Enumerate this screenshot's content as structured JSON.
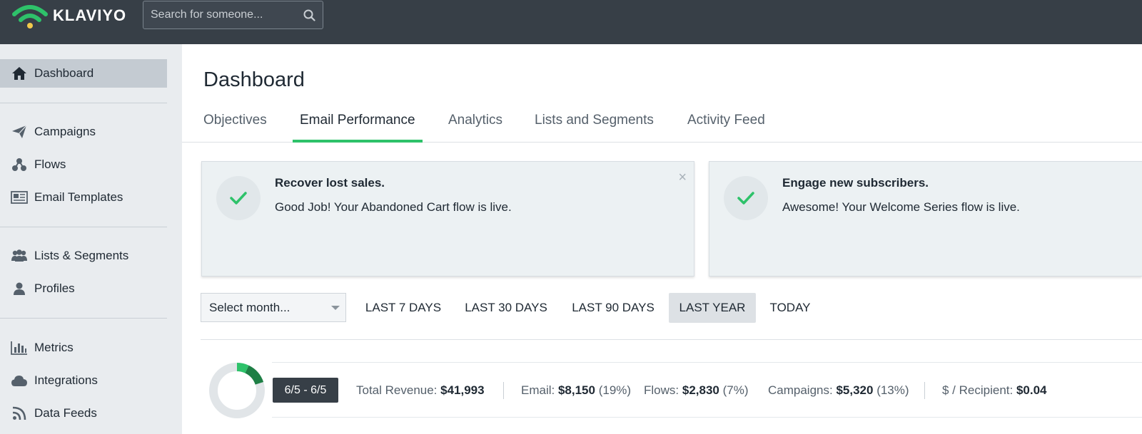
{
  "app": {
    "brand": "KLAVIYO",
    "search_placeholder": "Search for someone..."
  },
  "sidebar": {
    "items": [
      {
        "label": "Dashboard",
        "icon": "home-icon",
        "active": true
      },
      {
        "label": "Campaigns",
        "icon": "paper-plane-icon"
      },
      {
        "label": "Flows",
        "icon": "flows-icon"
      },
      {
        "label": "Email Templates",
        "icon": "newspaper-icon"
      },
      {
        "label": "Lists & Segments",
        "icon": "users-icon"
      },
      {
        "label": "Profiles",
        "icon": "user-icon"
      },
      {
        "label": "Metrics",
        "icon": "bar-chart-icon"
      },
      {
        "label": "Integrations",
        "icon": "cloud-icon"
      },
      {
        "label": "Data Feeds",
        "icon": "rss-icon"
      }
    ]
  },
  "main": {
    "title": "Dashboard",
    "tabs": [
      {
        "label": "Objectives"
      },
      {
        "label": "Email Performance",
        "active": true
      },
      {
        "label": "Analytics"
      },
      {
        "label": "Lists and Segments"
      },
      {
        "label": "Activity Feed"
      }
    ],
    "cards": [
      {
        "title": "Recover lost sales.",
        "body": "Good Job! Your Abandoned Cart flow is live.",
        "close": "×"
      },
      {
        "title": "Engage new subscribers.",
        "body": "Awesome! Your Welcome Series flow is live."
      }
    ],
    "filters": {
      "month_select": "Select month...",
      "ranges": [
        {
          "label": "LAST 7 DAYS"
        },
        {
          "label": "LAST 30 DAYS"
        },
        {
          "label": "LAST 90 DAYS"
        },
        {
          "label": "LAST YEAR",
          "active": true
        },
        {
          "label": "TODAY"
        }
      ]
    },
    "stats": {
      "date_range": "6/5 - 6/5",
      "total_revenue_label": "Total Revenue:",
      "total_revenue": "$41,993",
      "email_label": "Email:",
      "email_value": "$8,150",
      "email_pct": "(19%)",
      "flows_label": "Flows:",
      "flows_value": "$2,830",
      "flows_pct": "(7%)",
      "campaigns_label": "Campaigns:",
      "campaigns_value": "$5,320",
      "campaigns_pct": "(13%)",
      "per_recipient_label": "$ / Recipient:",
      "per_recipient_value": "$0.04",
      "donut": {
        "flows_fraction": 0.07,
        "campaigns_fraction": 0.13
      }
    }
  },
  "colors": {
    "topbar": "#373f47",
    "accent_green": "#2ec26a",
    "sidebar_bg": "#e9ecef",
    "sidebar_active": "#c4cbd2",
    "donut_flows": "#2ec26a",
    "donut_campaigns": "#1e7f45",
    "donut_track": "#e1e5e8"
  }
}
